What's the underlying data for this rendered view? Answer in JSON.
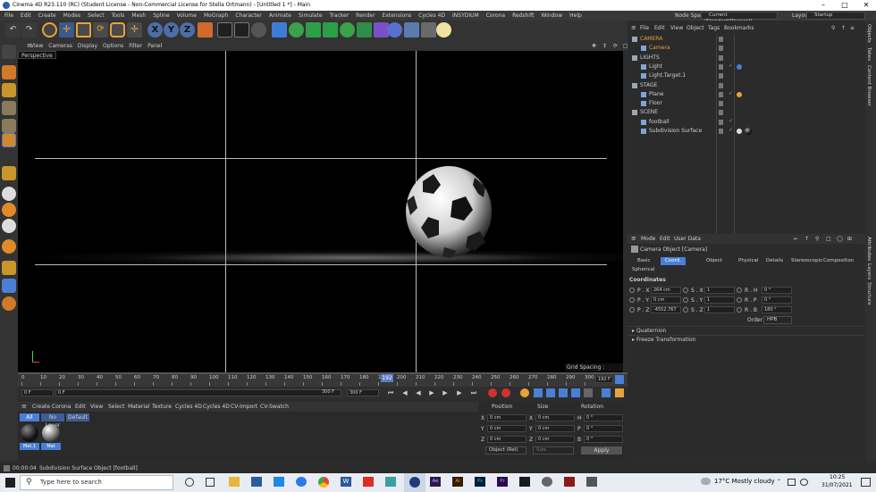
{
  "window": {
    "title": "Cinema 4D R23.110 (RC) (Student License - Non-Commercial License for Stella Ortmann) - [Untitled 1 *] - Main"
  },
  "menubar": {
    "items": [
      "File",
      "Edit",
      "Create",
      "Modes",
      "Select",
      "Tools",
      "Mesh",
      "Spline",
      "Volume",
      "MoGraph",
      "Character",
      "Animate",
      "Simulate",
      "Tracker",
      "Render",
      "Extensions",
      "Cycles 4D",
      "INSYDIUM",
      "Corona",
      "Redshift",
      "Window",
      "Help"
    ],
    "node_space_label": "Node Space:",
    "node_space_value": "Current (Standard/Physical)",
    "layout_label": "Layout:",
    "layout_value": "Startup"
  },
  "toolbar": {
    "axis_x": "X",
    "axis_y": "Y",
    "axis_z": "Z"
  },
  "viewport": {
    "menu": [
      "View",
      "Cameras",
      "Display",
      "Options",
      "Filter",
      "Panel"
    ],
    "label": "Perspective",
    "grid_spacing": "Grid Spacing : 10000 cm"
  },
  "timeline": {
    "ticks": [
      "0",
      "10",
      "20",
      "30",
      "40",
      "50",
      "60",
      "70",
      "80",
      "90",
      "100",
      "110",
      "120",
      "130",
      "140",
      "150",
      "160",
      "170",
      "180",
      "190",
      "200",
      "210",
      "220",
      "230",
      "240",
      "250",
      "260",
      "270",
      "280",
      "290",
      "300"
    ],
    "current_frame_marker": "192",
    "frame_display": "192 F"
  },
  "controls": {
    "start": "0 F",
    "current": "0 F",
    "end": "300 F",
    "end2": "300 F"
  },
  "materials": {
    "menu": [
      "Create",
      "Corona",
      "Edit",
      "View",
      "Select",
      "Material",
      "Texture",
      "Cycles 4D",
      "Cycles 4D",
      "CV-Import",
      "CV-Swatch"
    ],
    "filters": [
      "All",
      "No Layer",
      "Default"
    ],
    "items": [
      {
        "name": "Mat.1"
      },
      {
        "name": "Mat"
      }
    ]
  },
  "coords": {
    "headers": [
      "Position",
      "Size",
      "Rotation"
    ],
    "rows": [
      {
        "axis": "X",
        "pos": "0 cm",
        "size_axis": "X",
        "size": "0 cm",
        "rot_axis": "H",
        "rot": "0 °"
      },
      {
        "axis": "Y",
        "pos": "0 cm",
        "size_axis": "Y",
        "size": "0 cm",
        "rot_axis": "P",
        "rot": "0 °"
      },
      {
        "axis": "Z",
        "pos": "0 cm",
        "size_axis": "Z",
        "size": "0 cm",
        "rot_axis": "B",
        "rot": "0 °"
      }
    ],
    "mode": "Object (Rel)",
    "size_mode": "Size",
    "apply": "Apply"
  },
  "objects": {
    "menu": [
      "File",
      "Edit",
      "View",
      "Object",
      "Tags",
      "Bookmarks"
    ],
    "tree": [
      {
        "name": "CAMERA",
        "level": 0,
        "color": "#e8a23a"
      },
      {
        "name": "Camera",
        "level": 1,
        "color": "#e8a23a"
      },
      {
        "name": "LIGHTS",
        "level": 0,
        "color": "#cfcfcf"
      },
      {
        "name": "Light",
        "level": 1,
        "color": "#cfcfcf"
      },
      {
        "name": "Light.Target.1",
        "level": 1,
        "color": "#cfcfcf"
      },
      {
        "name": "STAGE",
        "level": 0,
        "color": "#cfcfcf"
      },
      {
        "name": "Plane",
        "level": 1,
        "color": "#cfcfcf"
      },
      {
        "name": "Floor",
        "level": 1,
        "color": "#cfcfcf"
      },
      {
        "name": "SCENE",
        "level": 0,
        "color": "#cfcfcf"
      },
      {
        "name": "football",
        "level": 1,
        "color": "#cfcfcf"
      },
      {
        "name": "Subdivision Surface",
        "level": 1,
        "color": "#cfcfcf"
      }
    ]
  },
  "attributes": {
    "menu": [
      "Mode",
      "Edit",
      "User Data"
    ],
    "object_title": "Camera Object [Camera]",
    "tabs": [
      "Basic",
      "Coord.",
      "Object",
      "Physical",
      "Details",
      "Stereoscopic",
      "Composition",
      "Spherical"
    ],
    "active_tab": "Coord.",
    "section": "Coordinates",
    "fields": [
      {
        "label": "P . X",
        "value": "264 cm",
        "slabel": "S . X",
        "svalue": "1",
        "rlabel": "R . H",
        "rvalue": "0 °"
      },
      {
        "label": "P . Y",
        "value": "0 cm",
        "slabel": "S . Y",
        "svalue": "1",
        "rlabel": "R . P",
        "rvalue": "0 °"
      },
      {
        "label": "P . Z",
        "value": "-4552.767",
        "slabel": "S . Z",
        "svalue": "1",
        "rlabel": "R . B",
        "rvalue": "180 °"
      }
    ],
    "order_label": "Order",
    "order_value": "HPB",
    "groups": [
      "Quaternion",
      "Freeze Transformation"
    ]
  },
  "right_tabs": [
    "Objects",
    "Takes",
    "Content Browser",
    "Attributes",
    "Layers",
    "Structure"
  ],
  "status": {
    "time": "00:00:04",
    "message": "Subdivision Surface Object [football]"
  },
  "taskbar": {
    "search_placeholder": "Type here to search",
    "weather": "17°C  Mostly cloudy",
    "clock_time": "10:25",
    "clock_date": "31/07/2021"
  },
  "colors": {
    "accent": "#4d7fd6",
    "active_object": "#e8a23a",
    "bg": "#2c2c2c"
  }
}
